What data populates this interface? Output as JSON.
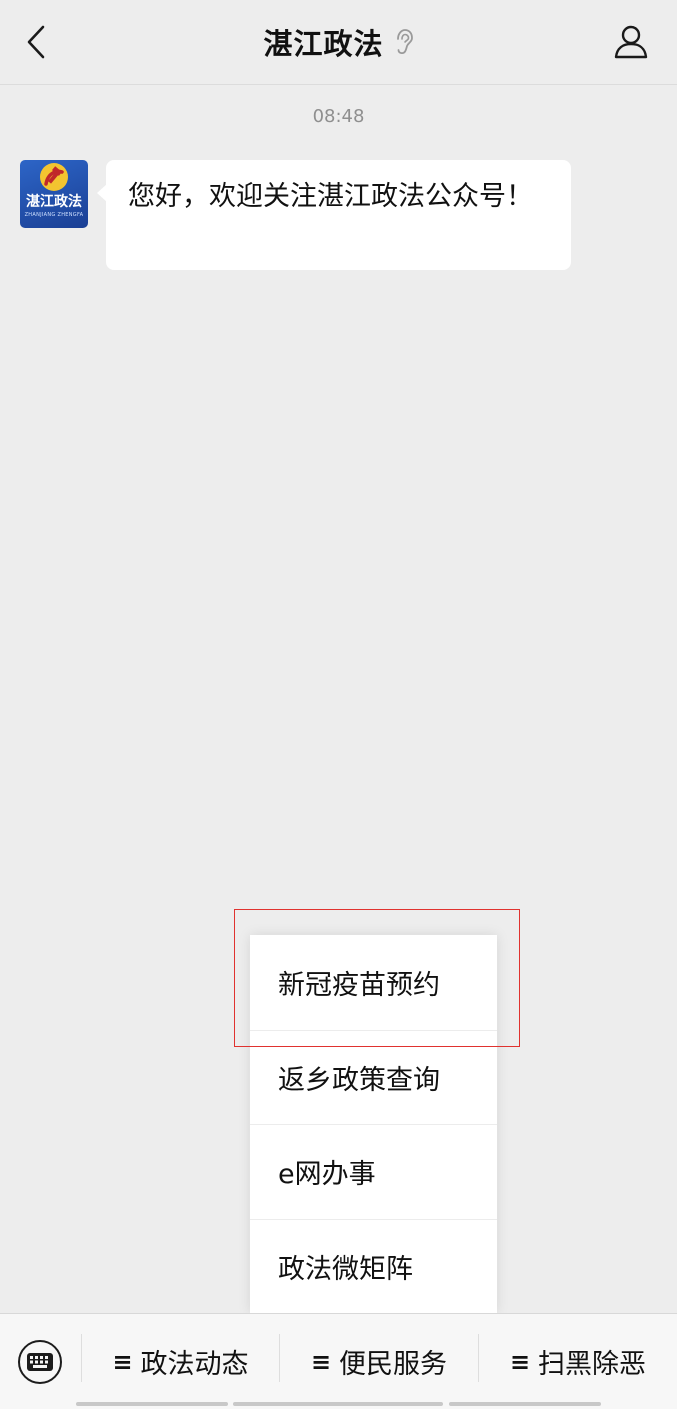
{
  "header": {
    "title": "湛江政法",
    "back_icon": "chevron-left-icon",
    "ear_icon": "ear-icon",
    "profile_icon": "person-icon"
  },
  "chat": {
    "timestamp": "08:48",
    "avatar": {
      "text": "湛江政法",
      "sub_text": "ZHANJIANG ZHENGFA",
      "emblem_icon": "party-emblem-icon"
    },
    "message": "您好，欢迎关注湛江政法公众号！"
  },
  "submenu": {
    "items": [
      {
        "label": "新冠疫苗预约"
      },
      {
        "label": "返乡政策查询"
      },
      {
        "label": "e网办事"
      },
      {
        "label": "政法微矩阵"
      }
    ],
    "highlight_color": "#e0322f"
  },
  "bottom_menu": {
    "keyboard_icon": "keyboard-icon",
    "tabs": [
      {
        "glyph": "≡",
        "label": "政法动态"
      },
      {
        "glyph": "≡",
        "label": "便民服务"
      },
      {
        "glyph": "≡",
        "label": "扫黑除恶"
      }
    ]
  }
}
